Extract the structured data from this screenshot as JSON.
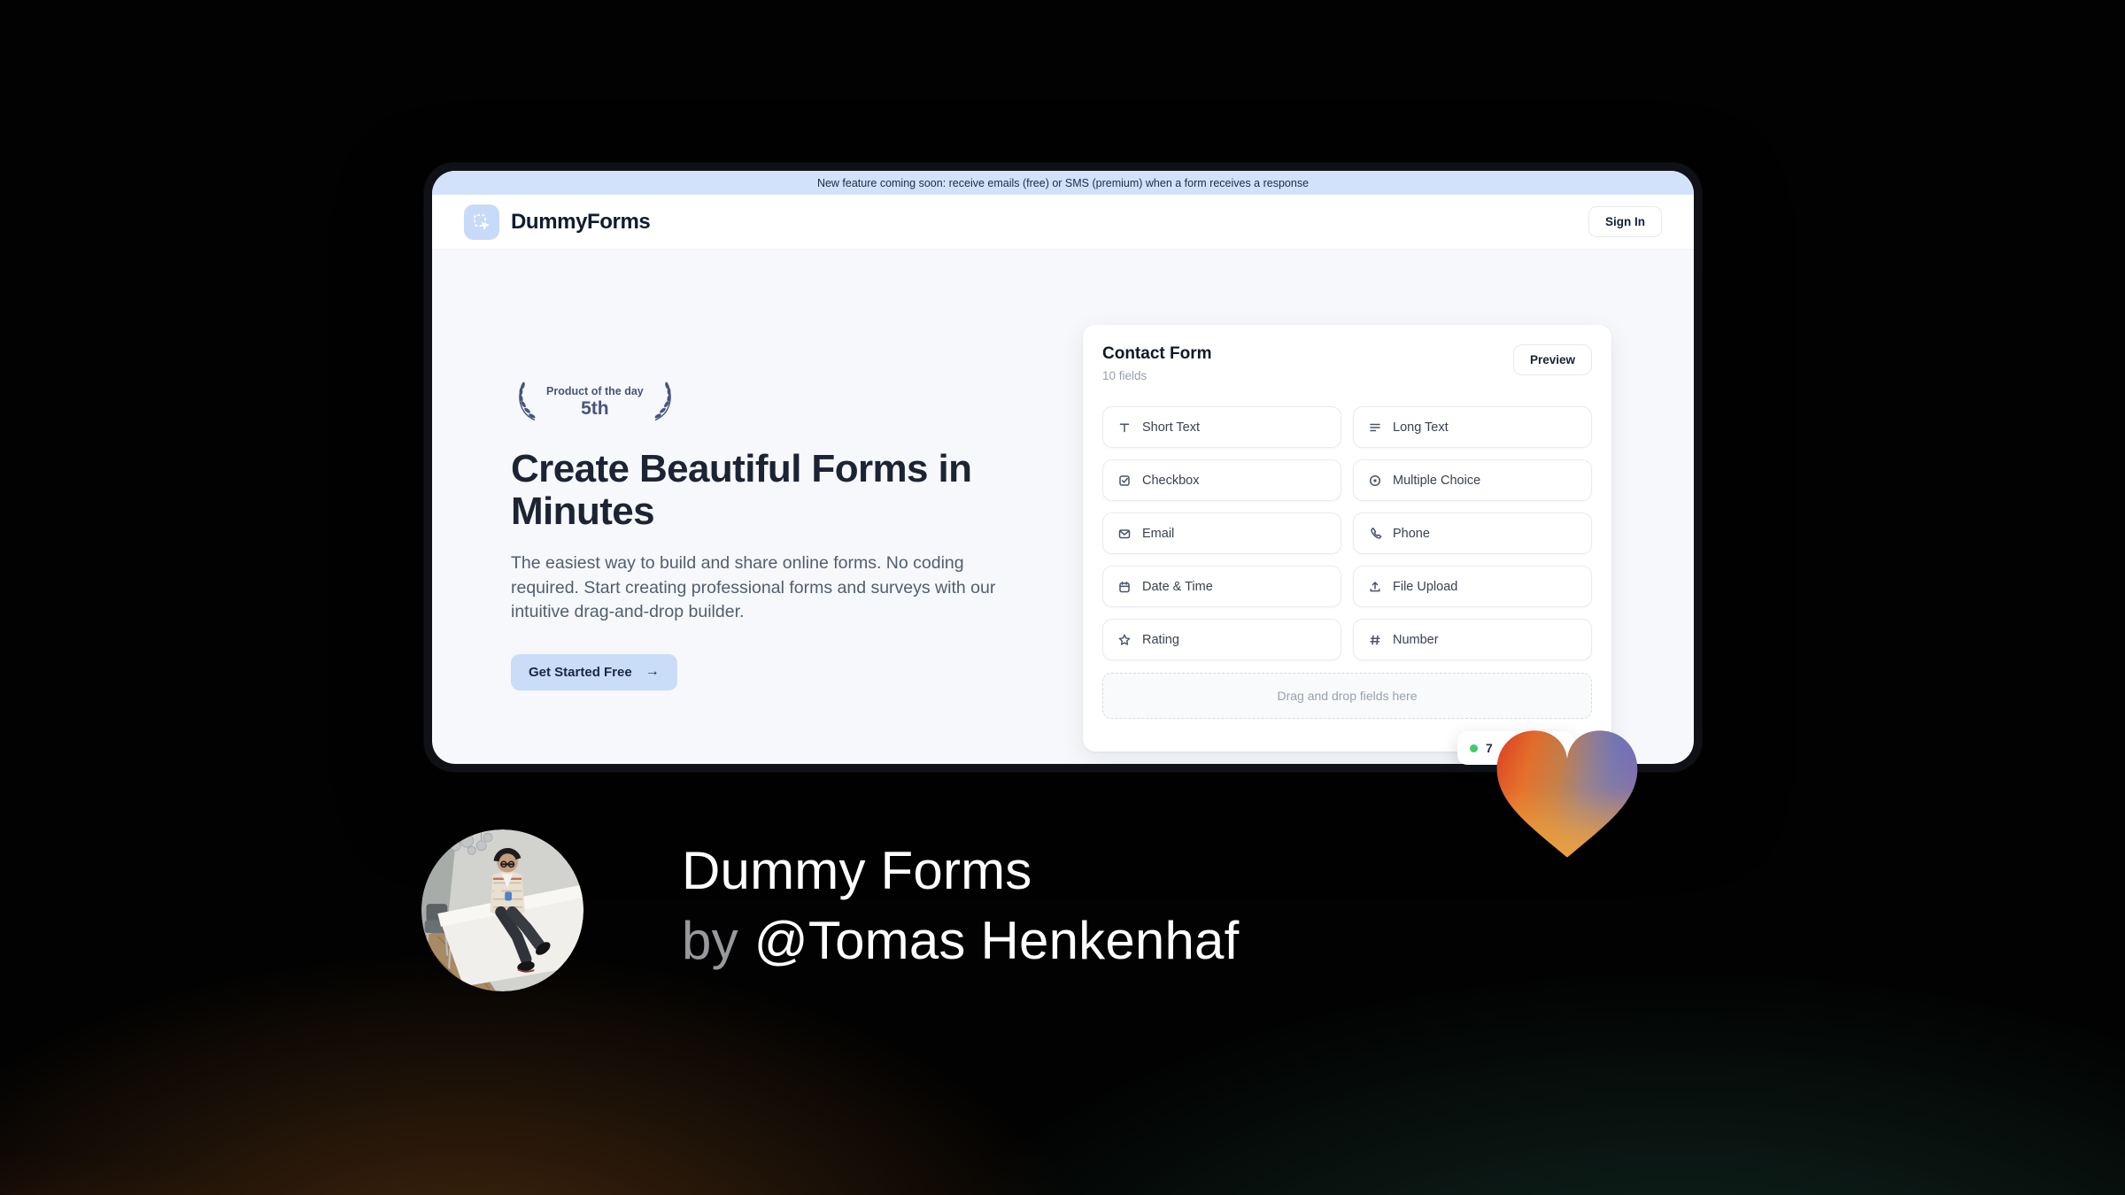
{
  "banner": {
    "text": "New feature coming soon: receive emails (free) or SMS (premium) when a form receives a response"
  },
  "header": {
    "brand": "DummyForms",
    "sign_in_label": "Sign In"
  },
  "hero": {
    "badge": {
      "line1": "Product of the day",
      "line2": "5th"
    },
    "title_line1": "Create Beautiful Forms in",
    "title_line2": "Minutes",
    "description": "The easiest way to build and share online forms. No coding required. Start creating professional forms and surveys with our intuitive drag-and-drop builder.",
    "cta_label": "Get Started Free",
    "cta_arrow": "→"
  },
  "builder_card": {
    "title": "Contact Form",
    "subtitle": "10 fields",
    "preview_label": "Preview",
    "fields": [
      {
        "label": "Short Text",
        "icon": "short-text-icon"
      },
      {
        "label": "Long Text",
        "icon": "long-text-icon"
      },
      {
        "label": "Checkbox",
        "icon": "checkbox-icon"
      },
      {
        "label": "Multiple Choice",
        "icon": "multiple-choice-icon"
      },
      {
        "label": "Email",
        "icon": "email-icon"
      },
      {
        "label": "Phone",
        "icon": "phone-icon"
      },
      {
        "label": "Date & Time",
        "icon": "calendar-icon"
      },
      {
        "label": "File Upload",
        "icon": "upload-icon"
      },
      {
        "label": "Rating",
        "icon": "star-icon"
      },
      {
        "label": "Number",
        "icon": "hash-icon"
      }
    ],
    "dropzone_text": "Drag and drop fields here"
  },
  "notification_badge": {
    "visible_text": "7",
    "dot_color": "#3fca6b"
  },
  "footer": {
    "title": "Dummy Forms",
    "byline_prefix": "by",
    "author": "@Tomas Henkenhaf"
  },
  "colors": {
    "banner_bg": "#d3e2fb",
    "accent_blue": "#c9ddf8",
    "heading_navy": "#1c2434",
    "laurel_slate": "#48547e",
    "badge_dot_green": "#3fca6b",
    "heart_red": "#dc3a21",
    "heart_orange": "#efa03c",
    "heart_purple": "#6d6ac2",
    "background_brown_glow": "#46290f",
    "background_teal_glow": "#143028"
  }
}
